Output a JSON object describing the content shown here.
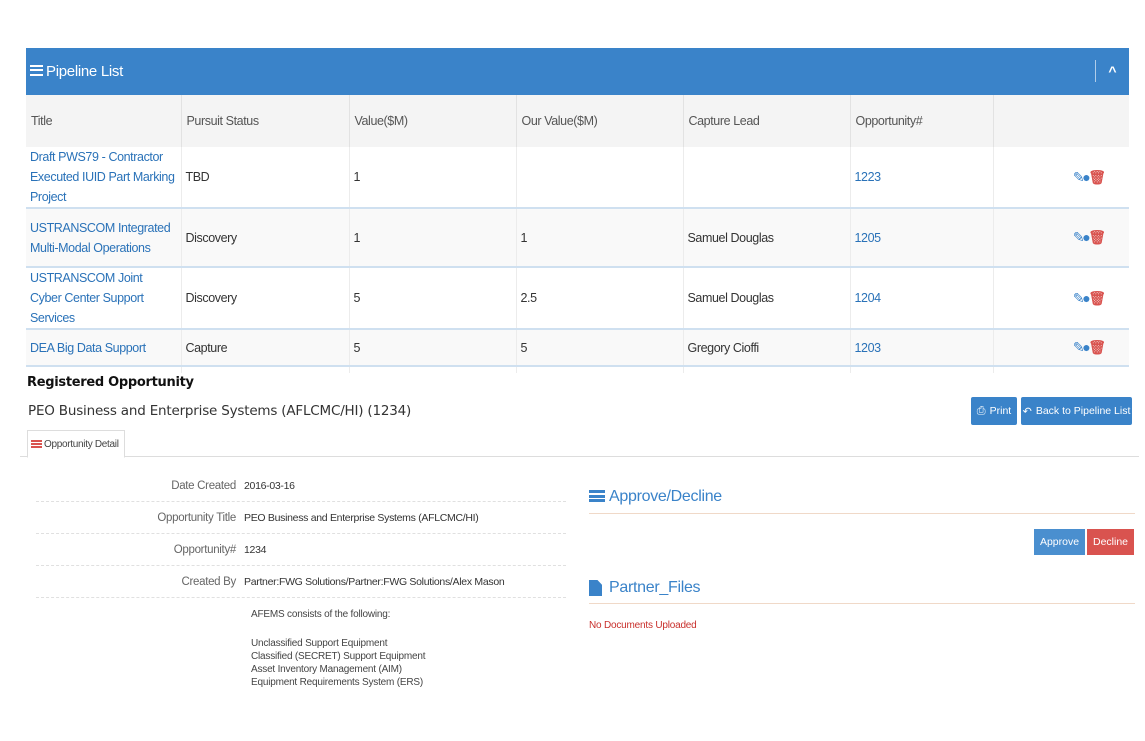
{
  "pipeline": {
    "title": "Pipeline List",
    "collapse_icon": "chevron-up-icon",
    "columns": [
      "Title",
      "Pursuit Status",
      "Value($M)",
      "Our Value($M)",
      "Capture Lead",
      "Opportunity#",
      ""
    ],
    "rows": [
      {
        "title": "Draft PWS79 - Contractor Executed IUID Part Marking Project",
        "status": "TBD",
        "value": "1",
        "our_value": "",
        "lead": "",
        "opp": "1223"
      },
      {
        "title": "USTRANSCOM Integrated Multi-Modal Operations",
        "status": "Discovery",
        "value": "1",
        "our_value": "1",
        "lead": "Samuel Douglas",
        "opp": "1205"
      },
      {
        "title": "USTRANSCOM Joint Cyber Center Support Services",
        "status": "Discovery",
        "value": "5",
        "our_value": "2.5",
        "lead": "Samuel Douglas",
        "opp": "1204"
      },
      {
        "title": "DEA Big Data Support",
        "status": "Capture",
        "value": "5",
        "our_value": "5",
        "lead": "Gregory Cioffi",
        "opp": "1203"
      }
    ],
    "action_icons": [
      "edit-icon",
      "comment-icon",
      "delete-icon"
    ]
  },
  "registered": {
    "label": "Registered Opportunity",
    "title": "PEO Business and Enterprise Systems (AFLCMC/HI) (1234)",
    "print_label": "Print",
    "back_label": "Back to Pipeline List",
    "tab_label": "Opportunity Detail"
  },
  "detail": {
    "fields": [
      {
        "label": "Date Created",
        "value": "2016-03-16"
      },
      {
        "label": "Opportunity Title",
        "value": "PEO Business and Enterprise Systems (AFLCMC/HI)"
      },
      {
        "label": "Opportunity#",
        "value": "1234"
      },
      {
        "label": "Created By",
        "value": "Partner:FWG Solutions/Partner:FWG Solutions/Alex Mason"
      }
    ],
    "description_intro": "AFEMS consists of the following:",
    "description_items": [
      "Unclassified Support Equipment",
      "Classified (SECRET) Support Equipment",
      "Asset Inventory Management (AIM)",
      "Equipment Requirements System (ERS)"
    ]
  },
  "approve": {
    "title": "Approve/Decline",
    "approve_label": "Approve",
    "decline_label": "Decline"
  },
  "files": {
    "title": "Partner_Files",
    "empty_text": "No Documents Uploaded"
  },
  "colors": {
    "primary": "#3a83c9",
    "danger": "#d9534f"
  }
}
